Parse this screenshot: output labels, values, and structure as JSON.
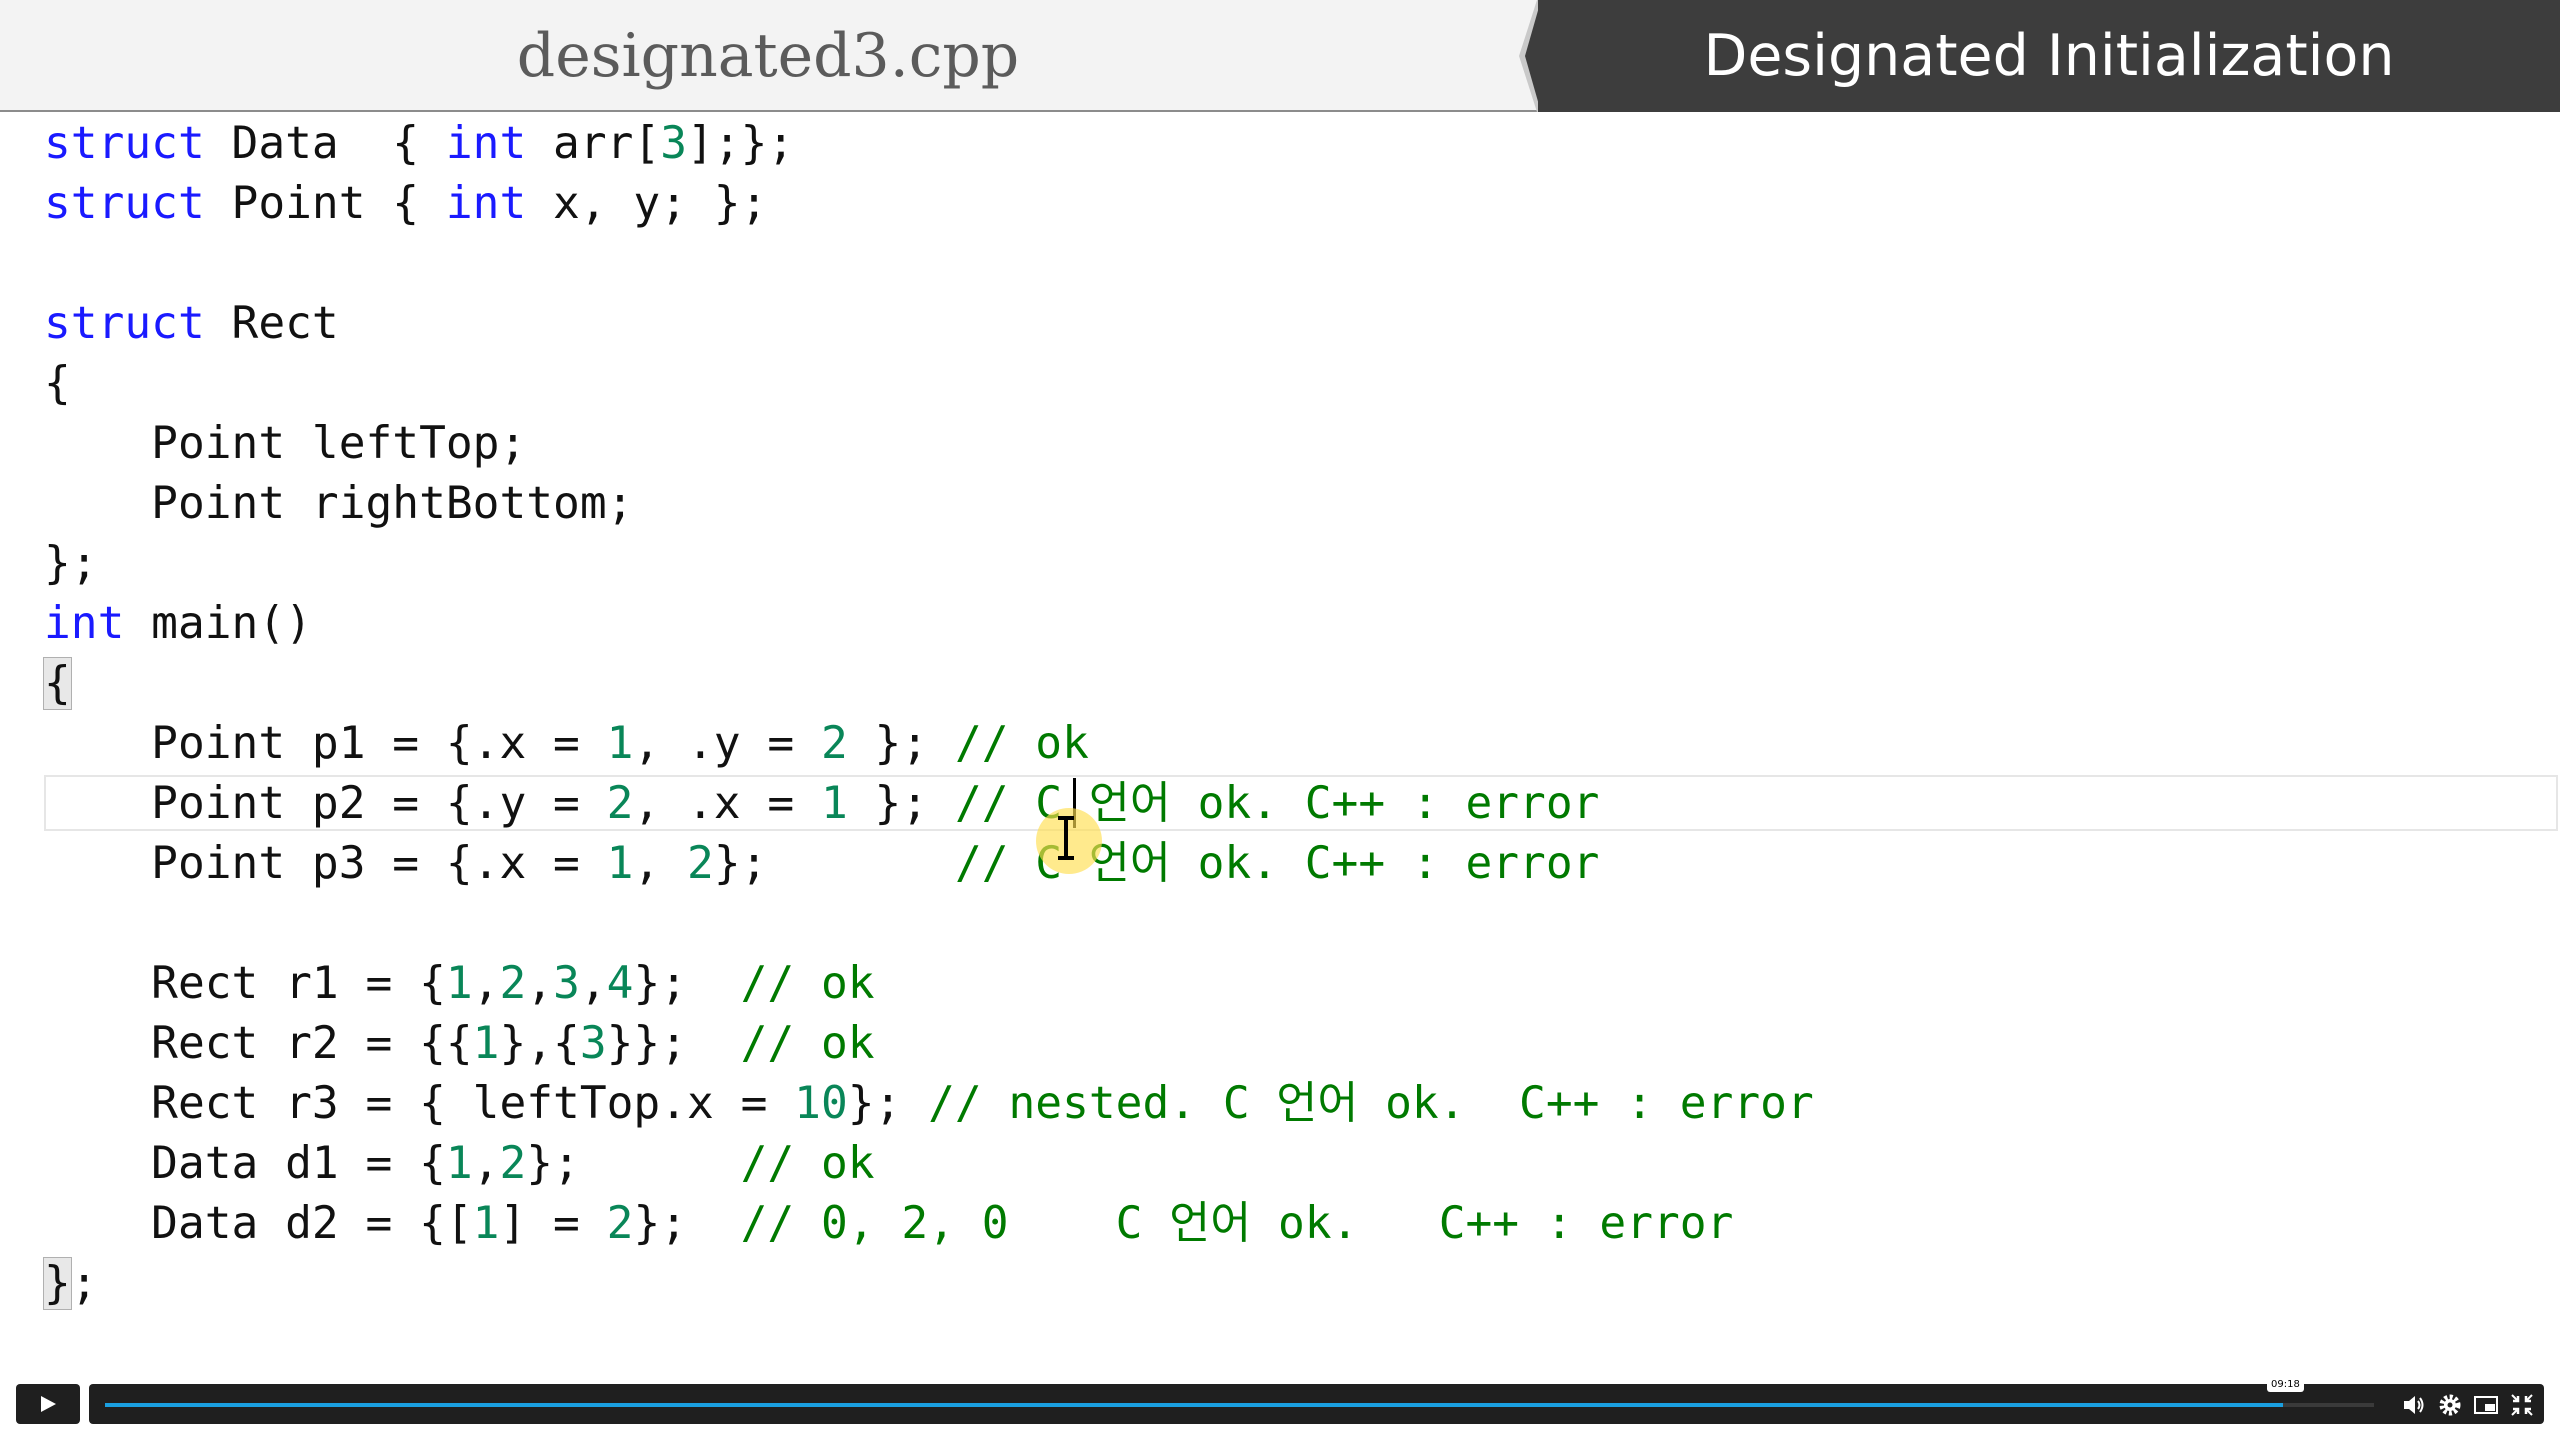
{
  "header": {
    "filename": "designated3.cpp",
    "topic": "Designated Initialization"
  },
  "code": {
    "l01": {
      "kw1": "struct",
      "t1": " Data  { ",
      "kw2": "int",
      "t2": " arr[",
      "n1": "3",
      "t3": "];};"
    },
    "l02": {
      "kw1": "struct",
      "t1": " Point { ",
      "kw2": "int",
      "t2": " x, y; };"
    },
    "l04": {
      "kw1": "struct",
      "t1": " Rect"
    },
    "l05": {
      "t1": "{"
    },
    "l06": {
      "t1": "    Point leftTop;"
    },
    "l07": {
      "t1": "    Point rightBottom;"
    },
    "l08": {
      "t1": "};"
    },
    "l09": {
      "kw1": "int",
      "t1": " main()"
    },
    "l10": {
      "t1": "{"
    },
    "l11": {
      "t1": "    Point p1 = {.x = ",
      "n1": "1",
      "t2": ", .y = ",
      "n2": "2",
      "t3": " }; ",
      "c1": "// ok"
    },
    "l12": {
      "t1": "    Point p2 = {.y = ",
      "n1": "2",
      "t2": ", .x = ",
      "n2": "1",
      "t3": " }; ",
      "c1": "// C 언어 ok. C++ : error"
    },
    "l13": {
      "t1": "    Point p3 = {.x = ",
      "n1": "1",
      "t2": ", ",
      "n2": "2",
      "t3": "};       ",
      "c1": "// C 언어 ok. C++ : error"
    },
    "l15": {
      "t1": "    Rect r1 = {",
      "n1": "1",
      "s1": ",",
      "n2": "2",
      "s2": ",",
      "n3": "3",
      "s3": ",",
      "n4": "4",
      "t2": "};  ",
      "c1": "// ok"
    },
    "l16": {
      "t1": "    Rect r2 = {{",
      "n1": "1",
      "t2": "},{",
      "n2": "3",
      "t3": "}};  ",
      "c1": "// ok"
    },
    "l17": {
      "t1": "    Rect r3 = { leftTop.x = ",
      "n1": "10",
      "t2": "}; ",
      "c1": "// nested. C 언어 ok.  C++ : error"
    },
    "l18": {
      "t1": "    Data d1 = {",
      "n1": "1",
      "s1": ",",
      "n2": "2",
      "t2": "};      ",
      "c1": "// ok"
    },
    "l19": {
      "t1": "    Data d2 = {[",
      "n1": "1",
      "t2": "] = ",
      "n2": "2",
      "t3": "};  ",
      "c1": "// 0, 2, 0    C 언어 ok.   C++ : error"
    },
    "l20": {
      "t1": "}",
      "t2": ";"
    }
  },
  "player": {
    "time_tooltip": "09:18",
    "progress_fraction": 0.96
  }
}
